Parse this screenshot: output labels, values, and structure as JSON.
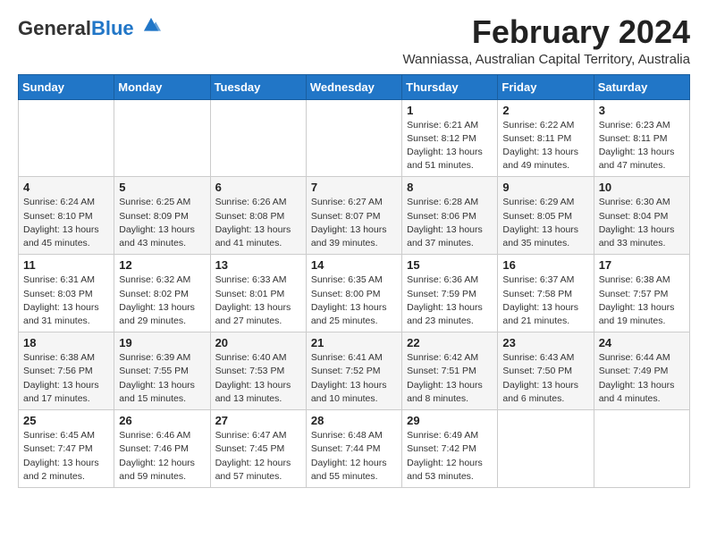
{
  "header": {
    "logo_general": "General",
    "logo_blue": "Blue",
    "month_title": "February 2024",
    "subtitle": "Wanniassa, Australian Capital Territory, Australia"
  },
  "days_of_week": [
    "Sunday",
    "Monday",
    "Tuesday",
    "Wednesday",
    "Thursday",
    "Friday",
    "Saturday"
  ],
  "weeks": [
    [
      {
        "num": "",
        "info": ""
      },
      {
        "num": "",
        "info": ""
      },
      {
        "num": "",
        "info": ""
      },
      {
        "num": "",
        "info": ""
      },
      {
        "num": "1",
        "info": "Sunrise: 6:21 AM\nSunset: 8:12 PM\nDaylight: 13 hours\nand 51 minutes."
      },
      {
        "num": "2",
        "info": "Sunrise: 6:22 AM\nSunset: 8:11 PM\nDaylight: 13 hours\nand 49 minutes."
      },
      {
        "num": "3",
        "info": "Sunrise: 6:23 AM\nSunset: 8:11 PM\nDaylight: 13 hours\nand 47 minutes."
      }
    ],
    [
      {
        "num": "4",
        "info": "Sunrise: 6:24 AM\nSunset: 8:10 PM\nDaylight: 13 hours\nand 45 minutes."
      },
      {
        "num": "5",
        "info": "Sunrise: 6:25 AM\nSunset: 8:09 PM\nDaylight: 13 hours\nand 43 minutes."
      },
      {
        "num": "6",
        "info": "Sunrise: 6:26 AM\nSunset: 8:08 PM\nDaylight: 13 hours\nand 41 minutes."
      },
      {
        "num": "7",
        "info": "Sunrise: 6:27 AM\nSunset: 8:07 PM\nDaylight: 13 hours\nand 39 minutes."
      },
      {
        "num": "8",
        "info": "Sunrise: 6:28 AM\nSunset: 8:06 PM\nDaylight: 13 hours\nand 37 minutes."
      },
      {
        "num": "9",
        "info": "Sunrise: 6:29 AM\nSunset: 8:05 PM\nDaylight: 13 hours\nand 35 minutes."
      },
      {
        "num": "10",
        "info": "Sunrise: 6:30 AM\nSunset: 8:04 PM\nDaylight: 13 hours\nand 33 minutes."
      }
    ],
    [
      {
        "num": "11",
        "info": "Sunrise: 6:31 AM\nSunset: 8:03 PM\nDaylight: 13 hours\nand 31 minutes."
      },
      {
        "num": "12",
        "info": "Sunrise: 6:32 AM\nSunset: 8:02 PM\nDaylight: 13 hours\nand 29 minutes."
      },
      {
        "num": "13",
        "info": "Sunrise: 6:33 AM\nSunset: 8:01 PM\nDaylight: 13 hours\nand 27 minutes."
      },
      {
        "num": "14",
        "info": "Sunrise: 6:35 AM\nSunset: 8:00 PM\nDaylight: 13 hours\nand 25 minutes."
      },
      {
        "num": "15",
        "info": "Sunrise: 6:36 AM\nSunset: 7:59 PM\nDaylight: 13 hours\nand 23 minutes."
      },
      {
        "num": "16",
        "info": "Sunrise: 6:37 AM\nSunset: 7:58 PM\nDaylight: 13 hours\nand 21 minutes."
      },
      {
        "num": "17",
        "info": "Sunrise: 6:38 AM\nSunset: 7:57 PM\nDaylight: 13 hours\nand 19 minutes."
      }
    ],
    [
      {
        "num": "18",
        "info": "Sunrise: 6:38 AM\nSunset: 7:56 PM\nDaylight: 13 hours\nand 17 minutes."
      },
      {
        "num": "19",
        "info": "Sunrise: 6:39 AM\nSunset: 7:55 PM\nDaylight: 13 hours\nand 15 minutes."
      },
      {
        "num": "20",
        "info": "Sunrise: 6:40 AM\nSunset: 7:53 PM\nDaylight: 13 hours\nand 13 minutes."
      },
      {
        "num": "21",
        "info": "Sunrise: 6:41 AM\nSunset: 7:52 PM\nDaylight: 13 hours\nand 10 minutes."
      },
      {
        "num": "22",
        "info": "Sunrise: 6:42 AM\nSunset: 7:51 PM\nDaylight: 13 hours\nand 8 minutes."
      },
      {
        "num": "23",
        "info": "Sunrise: 6:43 AM\nSunset: 7:50 PM\nDaylight: 13 hours\nand 6 minutes."
      },
      {
        "num": "24",
        "info": "Sunrise: 6:44 AM\nSunset: 7:49 PM\nDaylight: 13 hours\nand 4 minutes."
      }
    ],
    [
      {
        "num": "25",
        "info": "Sunrise: 6:45 AM\nSunset: 7:47 PM\nDaylight: 13 hours\nand 2 minutes."
      },
      {
        "num": "26",
        "info": "Sunrise: 6:46 AM\nSunset: 7:46 PM\nDaylight: 12 hours\nand 59 minutes."
      },
      {
        "num": "27",
        "info": "Sunrise: 6:47 AM\nSunset: 7:45 PM\nDaylight: 12 hours\nand 57 minutes."
      },
      {
        "num": "28",
        "info": "Sunrise: 6:48 AM\nSunset: 7:44 PM\nDaylight: 12 hours\nand 55 minutes."
      },
      {
        "num": "29",
        "info": "Sunrise: 6:49 AM\nSunset: 7:42 PM\nDaylight: 12 hours\nand 53 minutes."
      },
      {
        "num": "",
        "info": ""
      },
      {
        "num": "",
        "info": ""
      }
    ]
  ]
}
